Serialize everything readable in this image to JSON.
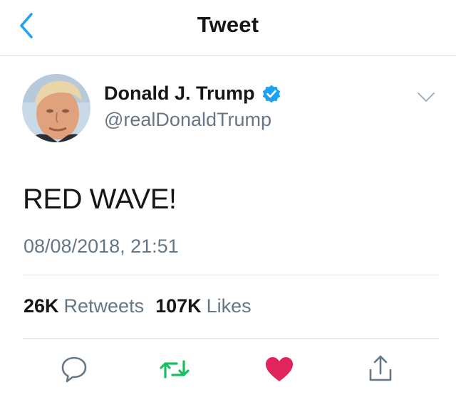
{
  "header": {
    "title": "Tweet"
  },
  "author": {
    "name": "Donald J. Trump",
    "handle": "@realDonaldTrump"
  },
  "tweet": {
    "text": "RED WAVE!",
    "timestamp": "08/08/2018, 21:51"
  },
  "stats": {
    "retweets_count": "26K",
    "retweets_label": "Retweets",
    "likes_count": "107K",
    "likes_label": "Likes"
  },
  "colors": {
    "accent": "#1da1f2",
    "retweet_green": "#17bf63",
    "like_red": "#e0245e",
    "secondary_text": "#657786"
  },
  "icons": [
    "back-chevron-icon",
    "verified-badge-icon",
    "chevron-down-icon",
    "reply-icon",
    "retweet-icon",
    "like-heart-icon",
    "share-icon"
  ]
}
